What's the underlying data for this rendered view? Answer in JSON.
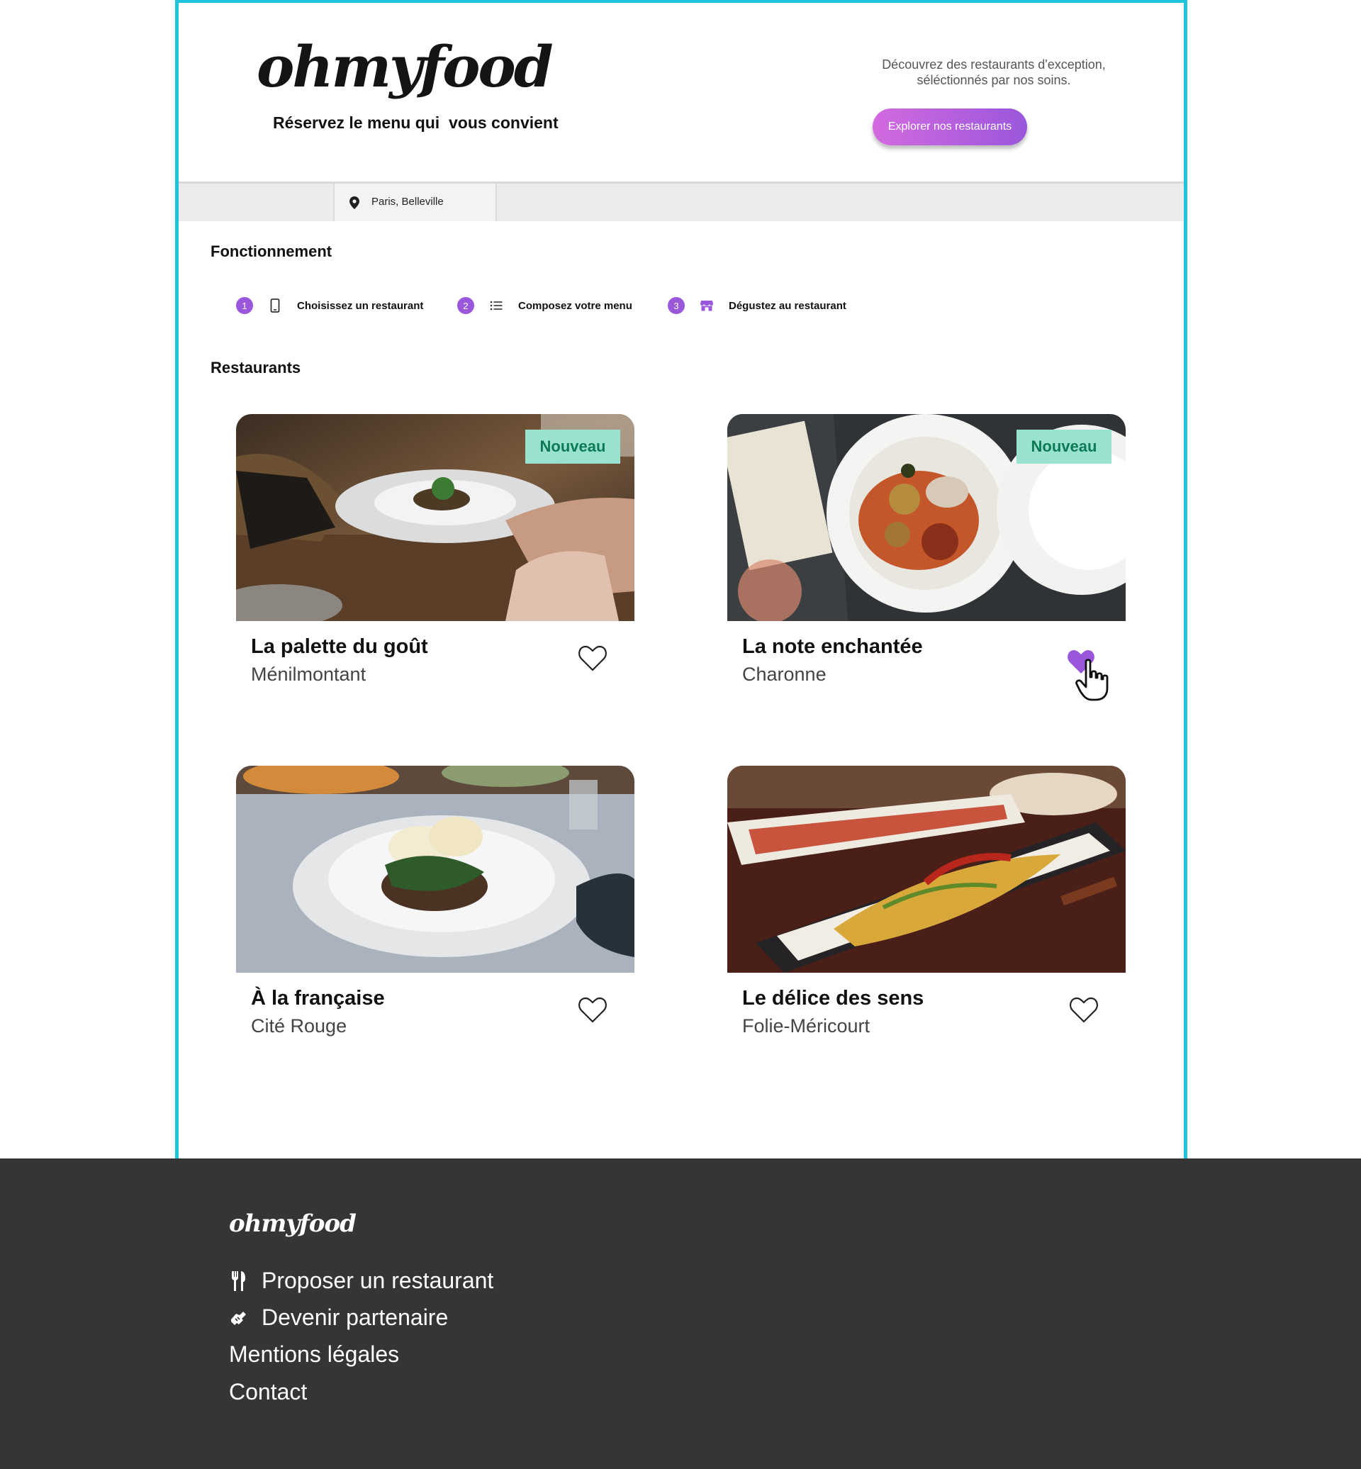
{
  "header": {
    "logo": "ohmyfood",
    "tagline": "Réservez le menu qui  vous convient",
    "hero_text_1": "Découvrez des restaurants d'exception,",
    "hero_text_2": "séléctionnés par nos soins.",
    "cta_label": "Explorer nos restaurants"
  },
  "location": {
    "label": "Paris, Belleville",
    "icon": "location-pin-icon"
  },
  "how_it_works": {
    "title": "Fonctionnement",
    "steps": [
      {
        "number": "1",
        "icon": "smartphone-icon",
        "label": "Choisissez un restaurant"
      },
      {
        "number": "2",
        "icon": "list-icon",
        "label": "Composez votre menu"
      },
      {
        "number": "3",
        "icon": "store-icon",
        "label": "Dégustez au restaurant"
      }
    ]
  },
  "restaurants": {
    "title": "Restaurants",
    "items": [
      {
        "name": "La palette du goût",
        "area": "Ménilmontant",
        "badge": "Nouveau",
        "favorite": false
      },
      {
        "name": "La note enchantée",
        "area": "Charonne",
        "badge": "Nouveau",
        "favorite": true
      },
      {
        "name": "À la française",
        "area": "Cité Rouge",
        "badge": "",
        "favorite": false
      },
      {
        "name": "Le délice des sens",
        "area": "Folie-Méricourt",
        "badge": "",
        "favorite": false
      }
    ]
  },
  "footer": {
    "logo": "ohmyfood",
    "links": [
      {
        "label": "Proposer un restaurant",
        "icon": "utensils-icon"
      },
      {
        "label": "Devenir partenaire",
        "icon": "handshake-icon"
      },
      {
        "label": "Mentions légales"
      },
      {
        "label": "Contact"
      }
    ]
  },
  "colors": {
    "accent": "#9a57dc",
    "cta_start": "#d36adf",
    "badge_bg": "#99e2d0",
    "badge_text": "#0d7a54",
    "frame": "#1fc3dd",
    "footer_bg": "#353535"
  }
}
